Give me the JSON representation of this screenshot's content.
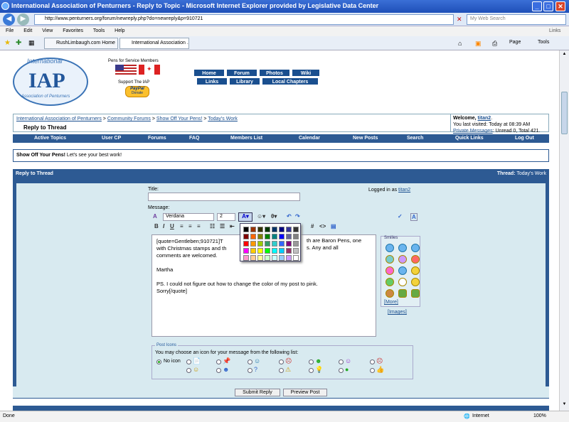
{
  "window": {
    "title": "International Association of Penturners - Reply to Topic - Microsoft Internet Explorer provided by Legislative Data Center"
  },
  "addressbar": {
    "url": "http://www.penturners.org/forum/newreply.php?do=newreply&p=910721",
    "search_placeholder": "My Web Search"
  },
  "menu": {
    "file": "File",
    "edit": "Edit",
    "view": "View",
    "favorites": "Favorites",
    "tools": "Tools",
    "help": "Help",
    "links": "Links"
  },
  "tabs": [
    {
      "label": "RushLimbaugh.com Home"
    },
    {
      "label": "International Association ..."
    }
  ],
  "commandbar": {
    "page": "Page",
    "tools": "Tools"
  },
  "header": {
    "logo_top": "International",
    "logo_main": "IAP",
    "logo_bottom": "Association of Penturners",
    "pens_label": "Pens for Service Members",
    "support_label": "Support The IAP",
    "paypal_label": "PayPal",
    "donate_label": "Donate"
  },
  "topnav": [
    {
      "label": "Home"
    },
    {
      "label": "Forum"
    },
    {
      "label": "Photos"
    },
    {
      "label": "Wiki"
    },
    {
      "label": "Links"
    },
    {
      "label": "Library"
    },
    {
      "label": "Local Chapters"
    }
  ],
  "breadcrumb": {
    "items": [
      "International Association of Penturners",
      "Community Forums",
      "Show Off Your Pens!",
      "Today's Work"
    ],
    "page": "Reply to Thread"
  },
  "welcome": {
    "prefix": "Welcome,",
    "user": "titan2",
    "visit": "You last visited: Today at",
    "time": "08:39 AM",
    "pm_link": "Private Messages",
    "pm_text": ": Unread 0, Total 421."
  },
  "forumnav": [
    {
      "label": "Active Topics"
    },
    {
      "label": "User CP"
    },
    {
      "label": "Forums"
    },
    {
      "label": "FAQ"
    },
    {
      "label": "Members List"
    },
    {
      "label": "Calendar"
    },
    {
      "label": "New Posts"
    },
    {
      "label": "Search"
    },
    {
      "label": "Quick Links"
    },
    {
      "label": "Log Out"
    }
  ],
  "forum_info": {
    "name": "Show Off Your Pens!",
    "desc": "Let's see your best work!"
  },
  "reply": {
    "heading": "Reply to Thread",
    "thread_label": "Thread:",
    "thread_name": "Today's Work",
    "title_label": "Title:",
    "logged_in": "Logged in as",
    "logged_user": "titan2",
    "message_label": "Message:"
  },
  "editor": {
    "font": "Verdana",
    "size": "2",
    "lines": [
      "[quote=Gentleben;910721]T",
      "with Christmas stamps and th",
      "comments are welcomed.",
      "",
      "Martha",
      "",
      "PS. I could not figure out how to change the color of my post to pink.",
      "Sorry[/quote]"
    ],
    "tail": [
      "th are Baron Pens, one",
      "s. Any and all"
    ]
  },
  "smilies": {
    "title": "Smilies",
    "more": "[More]",
    "images": "[Images]"
  },
  "posticons": {
    "title": "Post Icons",
    "desc": "You may choose an icon for your message from the following list:",
    "no_icon": "No icon"
  },
  "buttons": {
    "submit": "Submit Reply",
    "preview": "Preview Post"
  },
  "status": {
    "left": "Done",
    "zone": "Internet",
    "zoom": "100%"
  },
  "colors": {
    "palette": [
      "#000000",
      "#993300",
      "#333300",
      "#003300",
      "#003366",
      "#000080",
      "#333399",
      "#333333",
      "#800000",
      "#ff6600",
      "#808000",
      "#008000",
      "#008080",
      "#0000ff",
      "#666699",
      "#808080",
      "#ff0000",
      "#ff9900",
      "#99cc00",
      "#339966",
      "#33cccc",
      "#3366ff",
      "#800080",
      "#999999",
      "#ff00ff",
      "#ffcc00",
      "#ffff00",
      "#00ff00",
      "#00ffff",
      "#00ccff",
      "#993366",
      "#c0c0c0",
      "#ff99cc",
      "#ffcc99",
      "#ffff99",
      "#ccffcc",
      "#ccffff",
      "#99ccff",
      "#cc99ff",
      "#ffffff"
    ]
  }
}
